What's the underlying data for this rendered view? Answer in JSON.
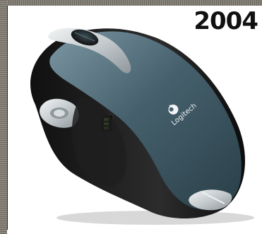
{
  "title": "2004",
  "logo": {
    "brand_text": "Logitech"
  },
  "colors": {
    "shell_blue": "#3f5a66",
    "body_black": "#1a1a1a",
    "accent_silver": "#c9ced1"
  }
}
